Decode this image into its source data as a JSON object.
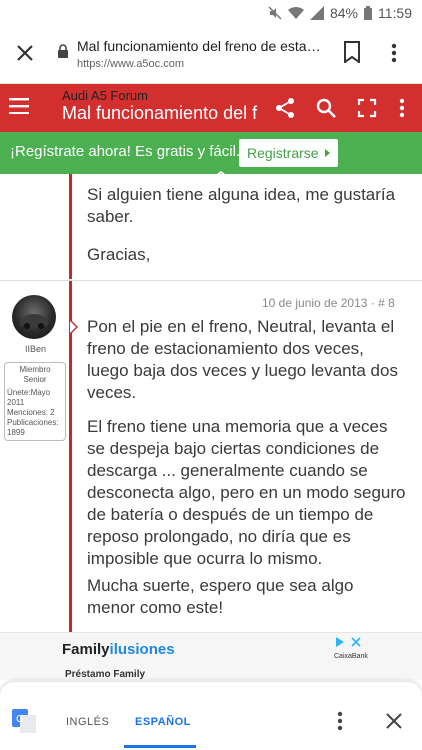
{
  "status_bar": {
    "battery": "84%",
    "time": "11:59"
  },
  "browser": {
    "page_title": "Mal funcionamiento del freno de estacio...",
    "url": "https://www.a5oc.com"
  },
  "forum_header": {
    "site_name": "Audi A5 Forum",
    "thread_title": "Mal funcionamiento del f"
  },
  "banner": {
    "text": "¡Regístrate ahora! Es gratis y fácil.",
    "button_label": "Registrarse"
  },
  "posts": [
    {
      "paragraphs": [
        "Si alguien tiene alguna idea, me gustaría saber.",
        "Gracias,"
      ]
    },
    {
      "username": "IIBen",
      "user_info": {
        "rank": "Miembro Senior",
        "lines": [
          "Únete:Mayo 2011",
          "Menciones: 2",
          "Publicaciones: 1899"
        ]
      },
      "date": "10 de junio de 2013 · # 8",
      "paragraphs": [
        "Pon el pie en el freno, Neutral, levanta el freno de estacionamiento dos veces, luego baja dos veces y luego levanta dos veces.",
        "El freno tiene una memoria que a veces se despeja bajo ciertas condiciones de descarga ... generalmente cuando se desconecta algo, pero en un modo seguro de batería o después de un tiempo de reposo prolongado, no diría que es imposible que ocurra lo mismo.",
        "Mucha suerte, espero que sea algo menor como este!"
      ]
    }
  ],
  "ad": {
    "brand_part1": "Family",
    "brand_part2": "ilusiones",
    "subtitle": "Préstamo Family",
    "sponsor": "CaixaBank"
  },
  "translate_bar": {
    "lang_source": "INGLÉS",
    "lang_target": "ESPAÑOL"
  },
  "colors": {
    "forum_red": "#d32f2f",
    "banner_green": "#4caf50",
    "accent_blue": "#1a73e8"
  }
}
